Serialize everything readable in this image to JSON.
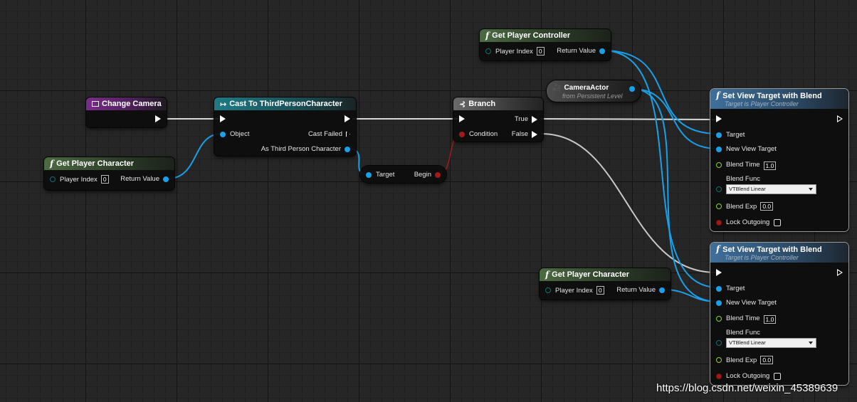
{
  "watermark": "https://blog.csdn.net/weixin_45389639",
  "nodes": {
    "change_camera": {
      "title": "Change Camera"
    },
    "get_player_character_1": {
      "title": "Get Player Character",
      "player_index_label": "Player Index",
      "player_index_value": "0",
      "return_label": "Return Value"
    },
    "cast": {
      "title": "Cast To ThirdPersonCharacter",
      "object_label": "Object",
      "cast_failed_label": "Cast Failed",
      "as_label": "As Third Person Character"
    },
    "reroute": {
      "target_label": "Target",
      "begin_label": "Begin"
    },
    "branch": {
      "title": "Branch",
      "true_label": "True",
      "condition_label": "Condition",
      "false_label": "False"
    },
    "get_player_controller": {
      "title": "Get Player Controller",
      "player_index_label": "Player Index",
      "player_index_value": "0",
      "return_label": "Return Value"
    },
    "camera_actor": {
      "title": "CameraActor",
      "subtitle": "from Persistent Level"
    },
    "set_view_1": {
      "title": "Set View Target with Blend",
      "subtitle": "Target is Player Controller",
      "target_label": "Target",
      "new_view_label": "New View Target",
      "blend_time_label": "Blend Time",
      "blend_time_value": "1.0",
      "blend_func_label": "Blend Func",
      "blend_func_value": "VTBlend Linear",
      "blend_exp_label": "Blend Exp",
      "blend_exp_value": "0.0",
      "lock_label": "Lock Outgoing"
    },
    "get_player_character_2": {
      "title": "Get Player Character",
      "player_index_label": "Player Index",
      "player_index_value": "0",
      "return_label": "Return Value"
    },
    "set_view_2": {
      "title": "Set View Target with Blend",
      "subtitle": "Target is Player Controller",
      "target_label": "Target",
      "new_view_label": "New View Target",
      "blend_time_label": "Blend Time",
      "blend_time_value": "1.0",
      "blend_func_label": "Blend Func",
      "blend_func_value": "VTBlend Linear",
      "blend_exp_label": "Blend Exp",
      "blend_exp_value": "0.0",
      "lock_label": "Lock Outgoing"
    }
  },
  "colors": {
    "exec_wire": "#ffffff",
    "object_wire": "#1aa0e8",
    "bool_wire": "#a31a1a",
    "background": "#262626"
  },
  "icons": {
    "function": "f-icon",
    "cast": "cast-arrow-icon",
    "branch": "branch-icon",
    "camera": "camera-icon",
    "event": "event-icon"
  }
}
